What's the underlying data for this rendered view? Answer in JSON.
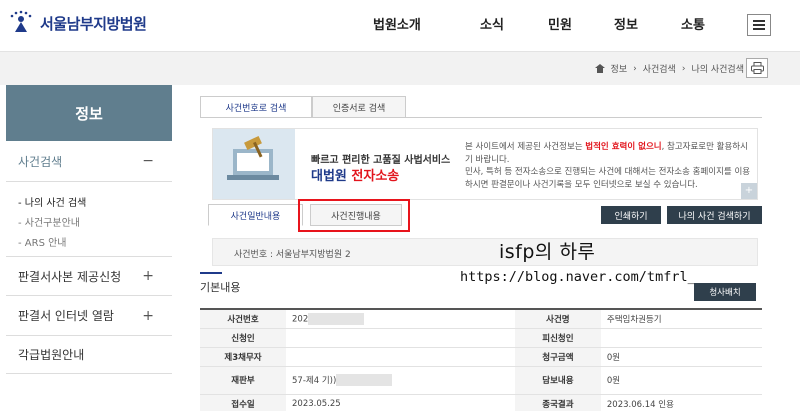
{
  "header": {
    "site_name": "서울남부지방법원",
    "nav": [
      "법원소개",
      "소식",
      "민원",
      "정보",
      "소통"
    ]
  },
  "breadcrumb": [
    "정보",
    "사건검색",
    "나의 사건검색"
  ],
  "sidebar": {
    "title": "정보",
    "categories": [
      {
        "label": "사건검색",
        "sign": "−"
      },
      {
        "label": "판결서사본 제공신청",
        "sign": "+"
      },
      {
        "label": "판결서 인터넷 열람",
        "sign": "+"
      },
      {
        "label": "각급법원안내",
        "sign": ""
      }
    ],
    "sub_items": [
      "- 나의 사건 검색",
      "- 사건구분안내",
      "- ARS 안내"
    ]
  },
  "tabs": [
    "사건번호로 검색",
    "인증서로 검색"
  ],
  "banner": {
    "line1": "빠르고 편리한 고품질 사법서비스",
    "line2a": "대법원",
    "line2b": "전자소송",
    "desc_a": "본 사이트에서 제공된 사건정보는 ",
    "desc_em": "법적인 효력이 없으니",
    "desc_b": ", 참고자료로만 활용하시기 바랍니다.",
    "desc_c": "민사, 특허 등 전자소송으로 진행되는 사건에 대해서는 전자소송 홈페이지를 이용하시면 판결문이나 사건기록을 모두 인터넷으로 보실 수 있습니다.",
    "corner": "+"
  },
  "sub_tabs": [
    "사건일반내용",
    "사건진행내용"
  ],
  "buttons": {
    "print": "인쇄하기",
    "my_case": "나의 사건 검색하기",
    "mail": "청사배치"
  },
  "case_number_label": "사건번호 : 서울남부지방법원 2",
  "overlay": {
    "title": "isfp의 하루",
    "url": "https://blog.naver.com/tmfrl_"
  },
  "section_title": "기본내용",
  "table": [
    {
      "l": "사건번호",
      "lv": "202",
      "r": "사건명",
      "rv": "주택임차권등기"
    },
    {
      "l": "신청인",
      "lv": "",
      "r": "피신청인",
      "rv": ""
    },
    {
      "l": "제3채무자",
      "lv": "",
      "r": "청구금액",
      "rv": "0원"
    },
    {
      "l": "재판부",
      "lv": "57-제4 기))",
      "r": "담보내용",
      "rv": "0원"
    },
    {
      "l": "접수일",
      "lv": "2023.05.25",
      "r": "종국결과",
      "rv": "2023.06.14 인용"
    }
  ]
}
